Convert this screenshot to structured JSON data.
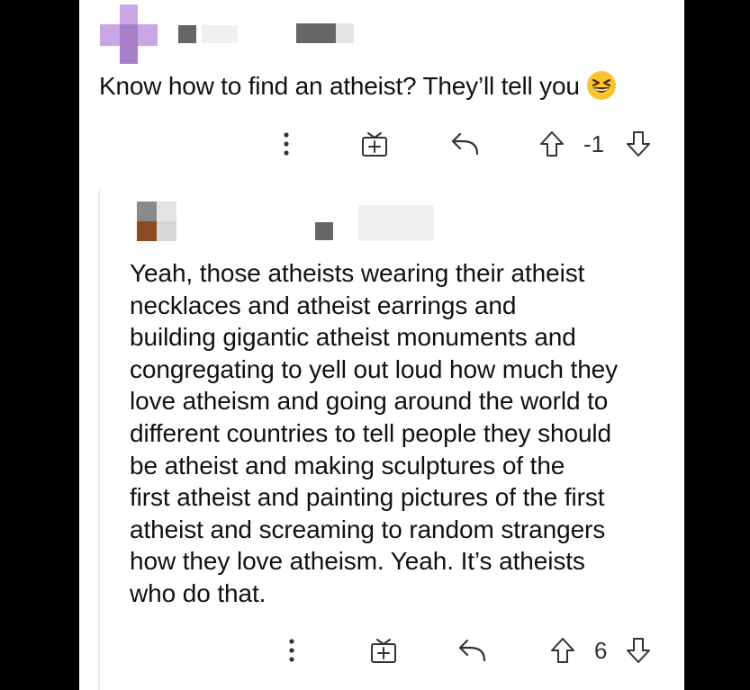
{
  "top_comment": {
    "text": "Know how to find an atheist? They’ll tell you",
    "emoji": "grinning-squinting-face",
    "score": "-1"
  },
  "reply": {
    "lines": [
      "Yeah, those atheists wearing their atheist",
      "necklaces and atheist earrings and",
      "building gigantic atheist monuments and",
      "congregating to yell out loud how much they",
      "love atheism and going around the world to",
      "different countries to tell people they should",
      "be atheist and making sculptures of the",
      "first atheist and painting pictures of the first",
      "atheist and screaming to random strangers",
      "how they love atheism. Yeah. It’s atheists",
      "who do that."
    ],
    "score": "6"
  },
  "icons": {
    "more": "more-vertical-icon",
    "award": "award-gift-icon",
    "reply": "reply-arrow-icon",
    "upvote": "upvote-arrow-icon",
    "downvote": "downvote-arrow-icon"
  }
}
